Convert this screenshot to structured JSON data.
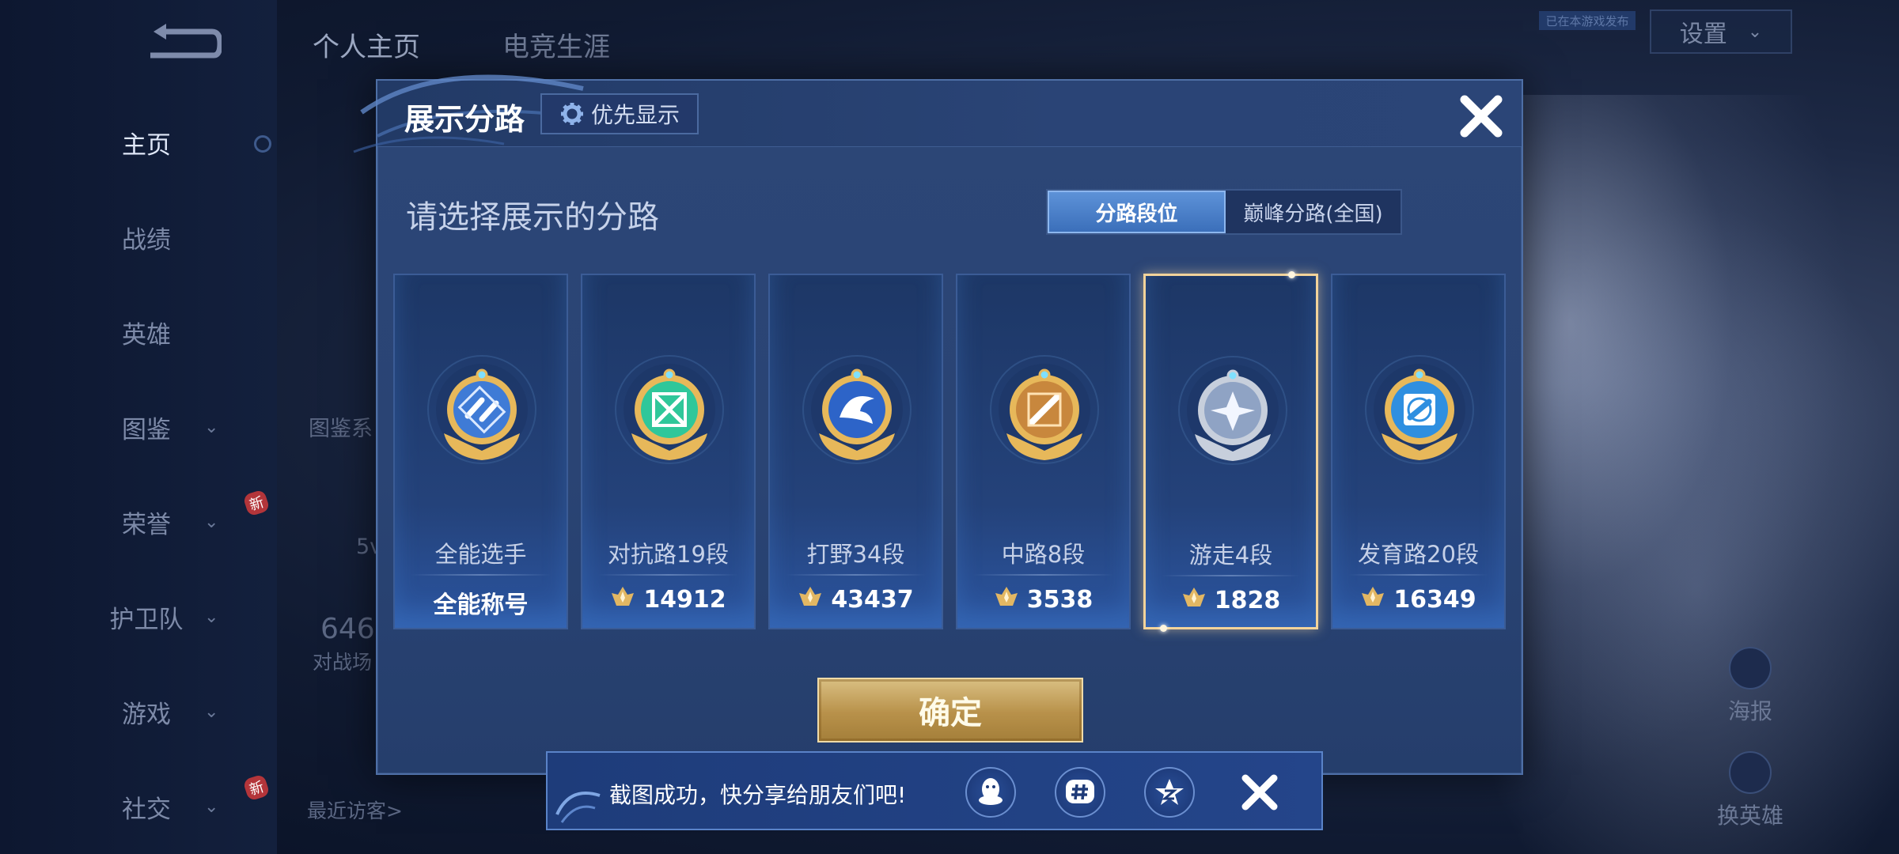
{
  "background": {
    "top_tabs": [
      "个人主页",
      "电竞生涯"
    ],
    "settings_label": "设置",
    "tiny_tag": "已在本游戏发布",
    "nav": [
      {
        "label": "主页",
        "chevron": false,
        "new": false,
        "active": true
      },
      {
        "label": "战绩",
        "chevron": false,
        "new": false,
        "active": false
      },
      {
        "label": "英雄",
        "chevron": false,
        "new": false,
        "active": false
      },
      {
        "label": "图鉴",
        "chevron": true,
        "new": false,
        "active": false
      },
      {
        "label": "荣誉",
        "chevron": true,
        "new": true,
        "active": false
      },
      {
        "label": "护卫队",
        "chevron": true,
        "new": false,
        "active": false
      },
      {
        "label": "游戏",
        "chevron": true,
        "new": false,
        "active": false
      },
      {
        "label": "社交",
        "chevron": true,
        "new": true,
        "active": false
      }
    ],
    "new_badge_text": "新",
    "right_buttons": [
      "海报",
      "换英雄"
    ],
    "profile_fragments": {
      "codex": "图鉴系",
      "vs": "5v",
      "count": "646",
      "battle": "对战场",
      "visitors": "最近访客>"
    }
  },
  "modal": {
    "title": "展示分路",
    "priority_button": "优先显示",
    "subtitle": "请选择展示的分路",
    "toggle": {
      "options": [
        "分路段位",
        "巅峰分路(全国)"
      ],
      "selected": 0
    },
    "lanes": [
      {
        "name": "全能选手",
        "score": "全能称号",
        "show_icon": false,
        "badge": "allround",
        "color": "#3f7bd6",
        "selected": false
      },
      {
        "name": "对抗路19段",
        "score": "14912",
        "show_icon": true,
        "badge": "clash",
        "color": "#2fc79a",
        "selected": false
      },
      {
        "name": "打野34段",
        "score": "43437",
        "show_icon": true,
        "badge": "jungle",
        "color": "#2d64c8",
        "selected": false
      },
      {
        "name": "中路8段",
        "score": "3538",
        "show_icon": true,
        "badge": "mid",
        "color": "#c8873d",
        "selected": false
      },
      {
        "name": "游走4段",
        "score": "1828",
        "show_icon": true,
        "badge": "roam",
        "color": "#8fa3c4",
        "selected": true
      },
      {
        "name": "发育路20段",
        "score": "16349",
        "show_icon": true,
        "badge": "farm",
        "color": "#2f8fe0",
        "selected": false
      }
    ],
    "confirm_label": "确定"
  },
  "toast": {
    "text": "截图成功，快分享给朋友们吧!",
    "icons": [
      "qq-icon",
      "hashtag-icon",
      "qzone-icon"
    ]
  },
  "colors": {
    "gold": "#f2d39a",
    "modal_bg": "#2a4474",
    "confirm": "#c4a061"
  }
}
